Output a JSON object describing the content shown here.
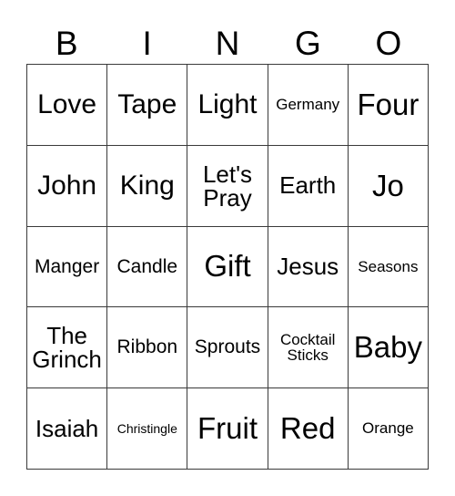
{
  "card": {
    "title_letters": [
      "B",
      "I",
      "N",
      "G",
      "O"
    ],
    "grid_line_color": "#3a3a3a",
    "background_color": "#ffffff",
    "text_color": "#000000",
    "columns": 5,
    "rows": 5,
    "cells": [
      {
        "text": "Love",
        "size": "sz-lg",
        "lines": 1
      },
      {
        "text": "Tape",
        "size": "sz-lg",
        "lines": 1
      },
      {
        "text": "Light",
        "size": "sz-lg",
        "lines": 1
      },
      {
        "text": "Germany",
        "size": "sz-xs",
        "lines": 1
      },
      {
        "text": "Four",
        "size": "sz-xl",
        "lines": 1
      },
      {
        "text": "John",
        "size": "sz-lg",
        "lines": 1
      },
      {
        "text": "King",
        "size": "sz-lg",
        "lines": 1
      },
      {
        "text": "Let's\nPray",
        "size": "sz-md",
        "lines": 2
      },
      {
        "text": "Earth",
        "size": "sz-md",
        "lines": 1
      },
      {
        "text": "Jo",
        "size": "sz-xl",
        "lines": 1
      },
      {
        "text": "Manger",
        "size": "sz-sm",
        "lines": 1
      },
      {
        "text": "Candle",
        "size": "sz-sm",
        "lines": 1
      },
      {
        "text": "Gift",
        "size": "sz-xl",
        "lines": 1
      },
      {
        "text": "Jesus",
        "size": "sz-md",
        "lines": 1
      },
      {
        "text": "Seasons",
        "size": "sz-xs",
        "lines": 1
      },
      {
        "text": "The\nGrinch",
        "size": "sz-md",
        "lines": 2
      },
      {
        "text": "Ribbon",
        "size": "sz-sm",
        "lines": 1
      },
      {
        "text": "Sprouts",
        "size": "sz-sm",
        "lines": 1
      },
      {
        "text": "Cocktail\nSticks",
        "size": "sz-xs",
        "lines": 2
      },
      {
        "text": "Baby",
        "size": "sz-xl",
        "lines": 1
      },
      {
        "text": "Isaiah",
        "size": "sz-md",
        "lines": 1
      },
      {
        "text": "Christingle",
        "size": "sz-xxs",
        "lines": 1
      },
      {
        "text": "Fruit",
        "size": "sz-xl",
        "lines": 1
      },
      {
        "text": "Red",
        "size": "sz-xl",
        "lines": 1
      },
      {
        "text": "Orange",
        "size": "sz-xs",
        "lines": 1
      }
    ]
  }
}
